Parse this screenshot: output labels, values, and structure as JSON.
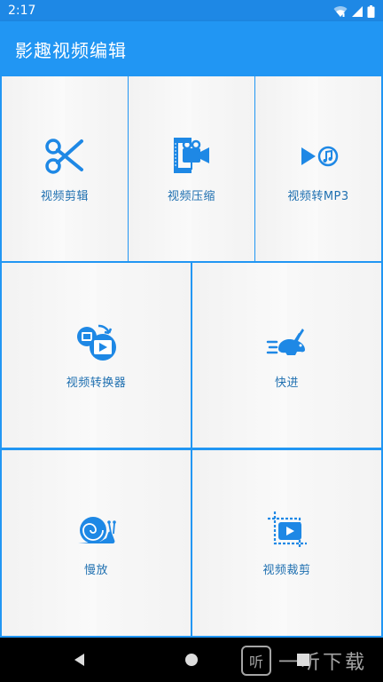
{
  "status_bar": {
    "time": "2:17",
    "icons": [
      "wifi-icon",
      "signal-icon",
      "battery-icon"
    ]
  },
  "app_bar": {
    "title": "影趣视频编辑"
  },
  "colors": {
    "primary": "#2196f3",
    "status_bar": "#1e88e5",
    "label": "#1e6fb0",
    "icon": "#1e88e5",
    "tile_bg": "#f5f5f5"
  },
  "tiles": [
    {
      "label": "视频剪辑",
      "icon": "scissors-icon"
    },
    {
      "label": "视频压缩",
      "icon": "clamp-camera-icon"
    },
    {
      "label": "视频转MP3",
      "icon": "play-music-icon"
    },
    {
      "label": "视频转换器",
      "icon": "convert-video-icon"
    },
    {
      "label": "快进",
      "icon": "rabbit-icon"
    },
    {
      "label": "慢放",
      "icon": "snail-icon"
    },
    {
      "label": "视频裁剪",
      "icon": "crop-video-icon"
    }
  ],
  "nav_bar": {
    "buttons": [
      "back-icon",
      "home-icon",
      "recents-icon"
    ]
  },
  "watermark": {
    "glyph": "听",
    "text": "一听下载"
  }
}
